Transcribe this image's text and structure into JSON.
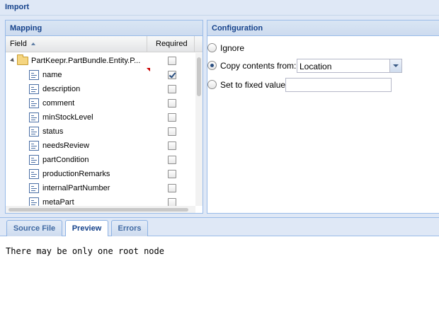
{
  "window": {
    "title": "Import"
  },
  "mapping": {
    "title": "Mapping",
    "columns": {
      "field": "Field",
      "required": "Required"
    },
    "root": {
      "label": "PartKeepr.PartBundle.Entity.P...",
      "required": false
    },
    "items": [
      {
        "label": "name",
        "required": true
      },
      {
        "label": "description",
        "required": false
      },
      {
        "label": "comment",
        "required": false
      },
      {
        "label": "minStockLevel",
        "required": false
      },
      {
        "label": "status",
        "required": false
      },
      {
        "label": "needsReview",
        "required": false
      },
      {
        "label": "partCondition",
        "required": false
      },
      {
        "label": "productionRemarks",
        "required": false
      },
      {
        "label": "internalPartNumber",
        "required": false
      },
      {
        "label": "metaPart",
        "required": false
      }
    ]
  },
  "configuration": {
    "title": "Configuration",
    "options": {
      "ignore": "Ignore",
      "copy": "Copy contents from:",
      "fixed": "Set to fixed value"
    },
    "selected": "copy",
    "copy_source": "Location",
    "fixed_value": ""
  },
  "tabs": [
    {
      "label": "Source File",
      "active": false
    },
    {
      "label": "Preview",
      "active": true
    },
    {
      "label": "Errors",
      "active": false
    }
  ],
  "preview": {
    "message": "There may be only one root node"
  },
  "colors": {
    "accent": "#15428b",
    "border": "#99bbe8",
    "background": "#dfe8f6"
  },
  "icons": {
    "root": "folder-icon",
    "item": "field-icon",
    "sort": "sort-asc-icon",
    "combo": "chevron-down-icon"
  }
}
